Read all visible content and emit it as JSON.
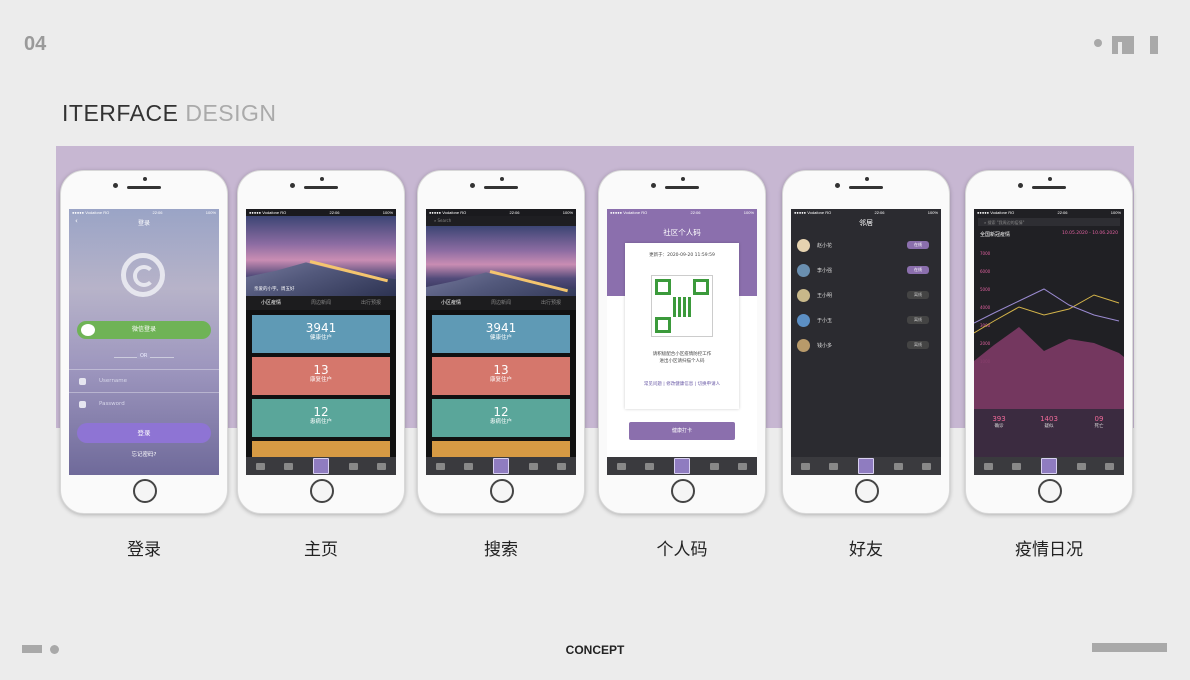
{
  "page": {
    "number": "04",
    "title_part1": "ITERFACE",
    "title_part2": "DESIGN",
    "footer": "CONCEPT"
  },
  "status_bar": {
    "carrier": "●●●●● Vodafone RO",
    "time": "22:06",
    "battery": "100%"
  },
  "screens": [
    {
      "caption": "登录",
      "header": "登录",
      "wechat_label": "微信登录",
      "or_label": "OR",
      "username_placeholder": "Username",
      "password_placeholder": "Password",
      "login_label": "登录",
      "forgot_label": "忘记密码?"
    },
    {
      "caption": "主页",
      "hero_caption": "亲爱的小宇。周五好",
      "tabs": [
        "小区疫情",
        "周边新闻",
        "出行预报"
      ],
      "stats": [
        {
          "value": "3941",
          "label": "健康住户",
          "color": "#5f9ab5"
        },
        {
          "value": "13",
          "label": "康复住户",
          "color": "#d5776c"
        },
        {
          "value": "12",
          "label": "患病住户",
          "color": "#5aa69a"
        }
      ]
    },
    {
      "caption": "搜索",
      "search_placeholder": "Search",
      "tabs": [
        "小区疫情",
        "周边新闻",
        "出行预报"
      ],
      "stats": [
        {
          "value": "3941",
          "label": "健康住户",
          "color": "#5f9ab5"
        },
        {
          "value": "13",
          "label": "康复住户",
          "color": "#d5776c"
        },
        {
          "value": "12",
          "label": "患病住户",
          "color": "#5aa69a"
        }
      ]
    },
    {
      "caption": "个人码",
      "title": "社区个人码",
      "updated": "更新于：2020-09-20  11:59:59",
      "desc_line1": "请积极配合小区疫情防控工作",
      "desc_line2": "进出小区请扫描个人码",
      "links": "常见问题 | 修改健康信息 | 切换申请人",
      "button": "健康打卡"
    },
    {
      "caption": "好友",
      "title": "邻居",
      "friends": [
        {
          "name": "赵小花",
          "status": "在线",
          "online": true
        },
        {
          "name": "李小强",
          "status": "在线",
          "online": true
        },
        {
          "name": "王小明",
          "status": "离线",
          "online": false
        },
        {
          "name": "于小玉",
          "status": "离线",
          "online": false
        },
        {
          "name": "钱小多",
          "status": "离线",
          "online": false
        }
      ]
    },
    {
      "caption": "疫情日况",
      "search_placeholder": "搜索 \"我周边的疫情\"",
      "chart_title": "全国新冠疫情",
      "date_range": "10.05.2020 - 10.06.2020",
      "y_ticks": [
        "7000",
        "6000",
        "5000",
        "4000",
        "3000",
        "2000",
        "1000"
      ],
      "kpis": [
        {
          "value": "393",
          "label": "确诊"
        },
        {
          "value": "1403",
          "label": "疑似"
        },
        {
          "value": "09",
          "label": "死亡"
        }
      ]
    }
  ]
}
